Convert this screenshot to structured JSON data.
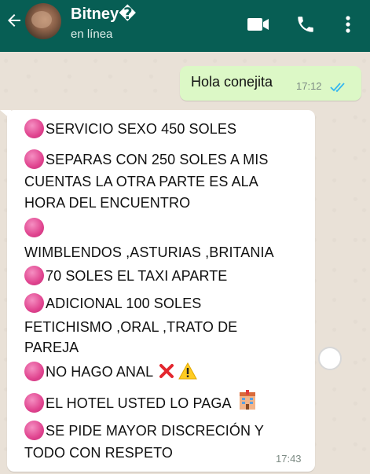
{
  "header": {
    "contact_name": "Bitney�",
    "status": "en línea",
    "background": "#075e54"
  },
  "icons": [
    "back-arrow-icon",
    "video-call-icon",
    "phone-icon",
    "more-options-icon",
    "read-ticks-icon",
    "cross-mark-icon",
    "warning-icon",
    "hotel-icon"
  ],
  "messages": {
    "outgoing": {
      "text": "Hola conejita",
      "time": "17:12",
      "bubble_color": "#dcf8c6",
      "tick_color": "#34b7f1"
    },
    "incoming": {
      "lines": [
        "SERVICIO SEXO 450 SOLES",
        "SEPARAS CON 250 SOLES A MIS",
        "CUENTAS LA OTRA PARTE ES ALA",
        "HORA DEL ENCUENTRO",
        "",
        "WIMBLENDOS ,ASTURIAS ,BRITANIA",
        "70 SOLES EL TAXI APARTE",
        "ADICIONAL 100 SOLES",
        "FETICHISMO ,ORAL ,TRATO DE",
        "PAREJA",
        "NO HAGO ANAL",
        "EL HOTEL USTED LO PAGA",
        "SE PIDE MAYOR DISCRECIÓN Y",
        "TODO CON RESPETO"
      ],
      "time": "17:43",
      "bullet_color": "#e0448f"
    }
  }
}
